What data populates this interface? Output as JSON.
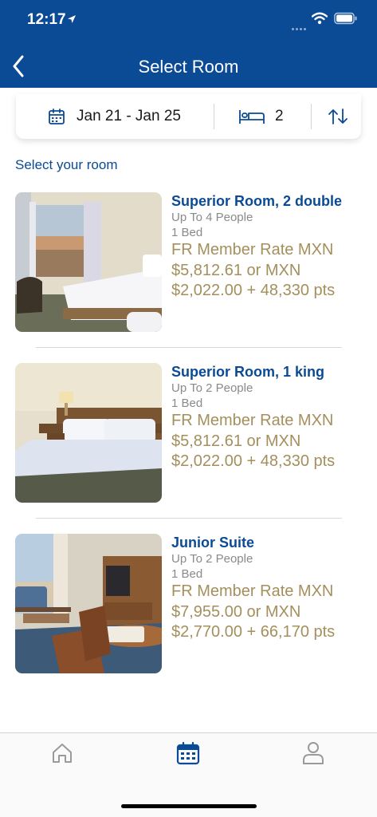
{
  "status_bar": {
    "time": "12:17"
  },
  "header": {
    "title": "Select Room"
  },
  "search": {
    "dates": "Jan 21 - Jan 25",
    "guests": "2"
  },
  "section_label": "Select your room",
  "rooms": [
    {
      "name": "Superior Room, 2 double",
      "people": "Up To 4 People",
      "beds": "1 Bed",
      "rate_line1": "FR Member Rate MXN",
      "rate_line2": "$5,812.61 or MXN",
      "rate_line3": "$2,022.00 + 48,330 pts"
    },
    {
      "name": "Superior Room, 1 king",
      "people": "Up To 2 People",
      "beds": "1 Bed",
      "rate_line1": "FR Member Rate MXN",
      "rate_line2": "$5,812.61 or MXN",
      "rate_line3": "$2,022.00 + 48,330 pts"
    },
    {
      "name": "Junior Suite",
      "people": "Up To 2 People",
      "beds": "1 Bed",
      "rate_line1": "FR Member Rate MXN",
      "rate_line2": "$7,955.00 or MXN",
      "rate_line3": "$2,770.00 + 66,170 pts"
    }
  ],
  "tabbar": {
    "items": [
      {
        "icon": "home-icon"
      },
      {
        "icon": "calendar-icon",
        "active": true
      },
      {
        "icon": "profile-icon"
      }
    ]
  },
  "colors": {
    "brand_blue": "#0b4a94",
    "rate_gold": "#a48f5d",
    "meta_gray": "#8a8a8a",
    "inactive_tab": "#9a9a9a"
  }
}
